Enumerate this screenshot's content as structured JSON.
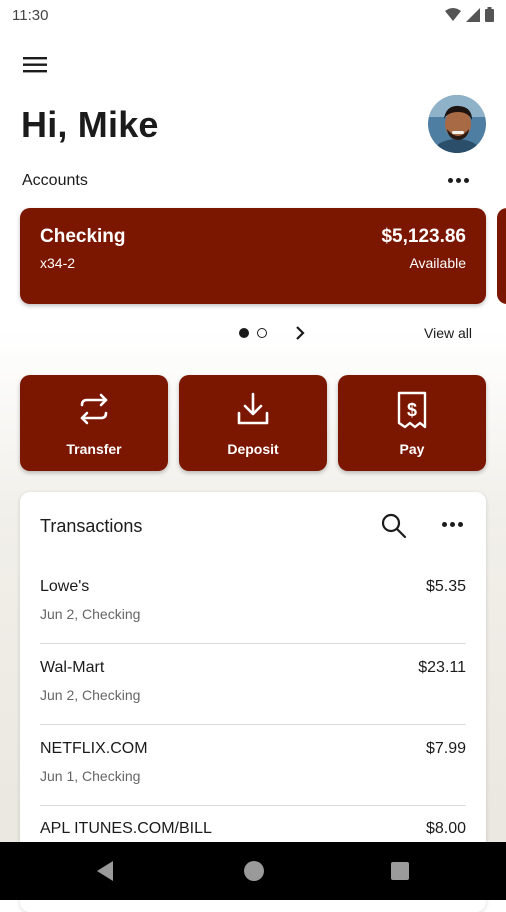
{
  "status_bar": {
    "time": "11:30",
    "icons": [
      "wifi-icon",
      "signal-icon",
      "battery-icon"
    ]
  },
  "header": {
    "greeting": "Hi, Mike",
    "avatar": "user-avatar"
  },
  "accounts": {
    "label": "Accounts",
    "cards": [
      {
        "name": "Checking",
        "number": "x34-2",
        "balance": "$5,123.86",
        "balance_label": "Available"
      }
    ],
    "pager": {
      "total": 2,
      "active": 1
    },
    "view_all": "View all"
  },
  "actions": [
    {
      "label": "Transfer",
      "icon": "transfer-icon"
    },
    {
      "label": "Deposit",
      "icon": "deposit-icon"
    },
    {
      "label": "Pay",
      "icon": "pay-icon"
    }
  ],
  "transactions": {
    "title": "Transactions",
    "items": [
      {
        "merchant": "Lowe's",
        "meta": "Jun 2, Checking",
        "amount": "$5.35"
      },
      {
        "merchant": "Wal-Mart",
        "meta": "Jun 2, Checking",
        "amount": "$23.11"
      },
      {
        "merchant": "NETFLIX.COM",
        "meta": "Jun 1, Checking",
        "amount": "$7.99"
      },
      {
        "merchant": "APL ITUNES.COM/BILL",
        "meta": "",
        "amount": "$8.00"
      }
    ]
  },
  "colors": {
    "brand": "#7b1600",
    "text": "#1b1b1b",
    "muted": "#666666"
  }
}
